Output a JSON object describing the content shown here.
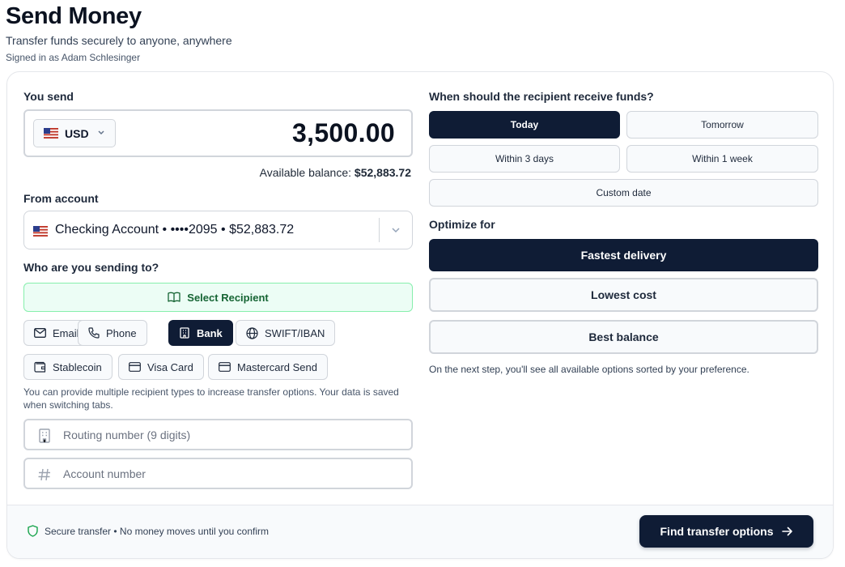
{
  "page": {
    "title": "Send Money",
    "subtitle": "Transfer funds securely to anyone, anywhere",
    "signed_in": "Signed in as Adam Schlesinger"
  },
  "send": {
    "label": "You send",
    "currency": "USD",
    "amount": "3,500.00",
    "balance_label": "Available balance:",
    "balance_value": "$52,883.72"
  },
  "from_account": {
    "label": "From account",
    "selected": "Checking Account • ••••2095 • $52,883.72"
  },
  "recipient": {
    "label": "Who are you sending to?",
    "select_button": "Select Recipient",
    "types": [
      {
        "label": "Email",
        "icon": "mail-icon"
      },
      {
        "label": "Phone",
        "icon": "phone-icon"
      },
      {
        "label": "Bank",
        "icon": "building-icon"
      },
      {
        "label": "SWIFT/IBAN",
        "icon": "globe-icon"
      },
      {
        "label": "Stablecoin",
        "icon": "wallet-icon"
      },
      {
        "label": "Visa Card",
        "icon": "card-icon"
      },
      {
        "label": "Mastercard Send",
        "icon": "card-icon"
      }
    ],
    "active_type": "Bank",
    "hint": "You can provide multiple recipient types to increase transfer options. Your data is saved when switching tabs.",
    "routing_placeholder": "Routing number (9 digits)",
    "account_placeholder": "Account number",
    "routing_value": "",
    "account_value": ""
  },
  "delivery": {
    "label": "When should the recipient receive funds?",
    "options": [
      "Today",
      "Tomorrow",
      "Within 3 days",
      "Within 1 week",
      "Custom date"
    ],
    "selected": "Today"
  },
  "optimize": {
    "label": "Optimize for",
    "options": [
      "Fastest delivery",
      "Lowest cost",
      "Best balance"
    ],
    "selected": "Fastest delivery",
    "note": "On the next step, you'll see all available options sorted by your preference."
  },
  "footer": {
    "secure_text": "Secure transfer • No money moves until you confirm",
    "cta": "Find transfer options"
  },
  "colors": {
    "primary": "#0f1c35",
    "success_bg": "#ecfdf5",
    "success_border": "#86efac",
    "success_text": "#166534"
  }
}
